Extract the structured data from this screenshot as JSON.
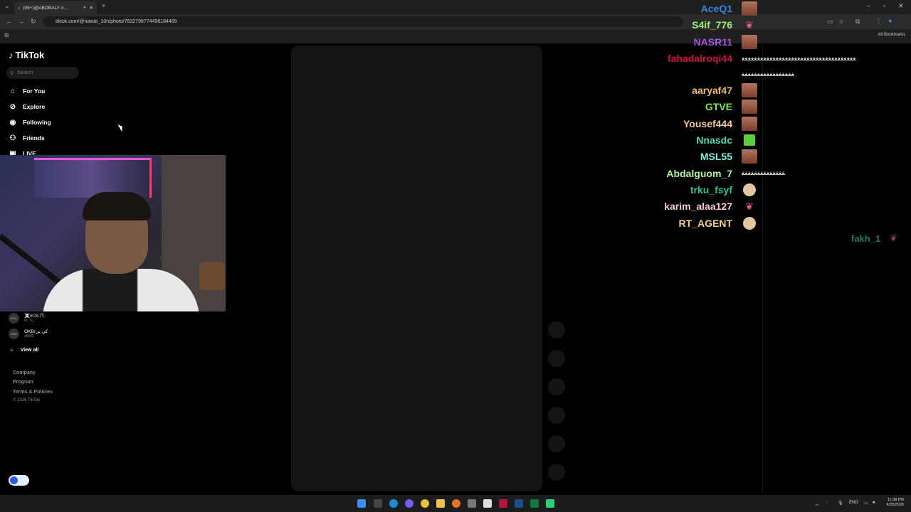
{
  "browser": {
    "tab_title": "(99+)@ABOBALY #...",
    "url": "tiktok.com/@nawar_10n/photo/7632798774498184469",
    "all_bookmarks": "All Bookmarks"
  },
  "tiktok": {
    "logo": "TikTok",
    "search_placeholder": "Search",
    "nav": [
      "For You",
      "Explore",
      "Following",
      "Friends",
      "LIVE"
    ],
    "accounts": [
      {
        "name": "☠️m7c ☈",
        "handle": "m_7c_",
        "avatar": "M7C"
      },
      {
        "name": "OKB/كي بي",
        "handle": "okb99",
        "avatar": "OKB"
      }
    ],
    "view_all": "View all",
    "footer": [
      "Company",
      "Program",
      "Terms & Policies",
      "© 2026 TikTok"
    ]
  },
  "chat": {
    "messages": [
      {
        "user": "AceQ1",
        "color": "#3b86e0",
        "avatar": "photo",
        "text": ""
      },
      {
        "user": "S4if_776",
        "color": "#9cf076",
        "avatar": "pink",
        "text": ""
      },
      {
        "user": "NASR11",
        "color": "#a455e3",
        "avatar": "photo",
        "text": ""
      },
      {
        "user": "fahadalroqi44",
        "color": "#d0103e",
        "avatar": "",
        "text": "ﻐﻐﻐﻐﻐﻐﻐﻐﻐﻐﻐﻐﻐﻐﻐﻐﻐﻐﻐﻐﻐﻐﻐﻐﻐﻐﻐﻐﻐﻐﻐﻐﻐﻐﻐﻐﻐ"
      },
      {
        "user": "aaryaf47",
        "color": "#f2b874",
        "avatar": "photo",
        "text": ""
      },
      {
        "user": "GTVE",
        "color": "#88e84a",
        "avatar": "photo",
        "text": ""
      },
      {
        "user": "Yousef444",
        "color": "#f5c79a",
        "avatar": "photo",
        "text": ""
      },
      {
        "user": "Nnasdc",
        "color": "#58d8b0",
        "avatar": "green",
        "text": ""
      },
      {
        "user": "MSL55",
        "color": "#7ff0e0",
        "avatar": "photo",
        "text": ""
      },
      {
        "user": "Abdalguom_7",
        "color": "#b7f39a",
        "avatar": "",
        "text": "ﻐﻐﻐﻐﻐﻐﻐﻐﻐﻐﻐﻐﻐﻐ"
      },
      {
        "user": "trku_fsyf",
        "color": "#27c794",
        "avatar": "face",
        "text": ""
      },
      {
        "user": "karim_alaa127",
        "color": "#f5c8d8",
        "avatar": "pink",
        "text": ""
      },
      {
        "user": "RT_AGENT",
        "color": "#f6ce89",
        "avatar": "face",
        "text": ""
      }
    ],
    "wrap_line": "ﻐﻐﻐﻐﻐﻐﻐﻐﻐﻐﻐﻐﻐﻐﻐﻐﻐ",
    "side_user": "fakh_1",
    "side_color": "#1f7a63"
  },
  "taskbar": {
    "lang": "ENG",
    "time": "11:38 PM",
    "date": "4/25/2026"
  }
}
